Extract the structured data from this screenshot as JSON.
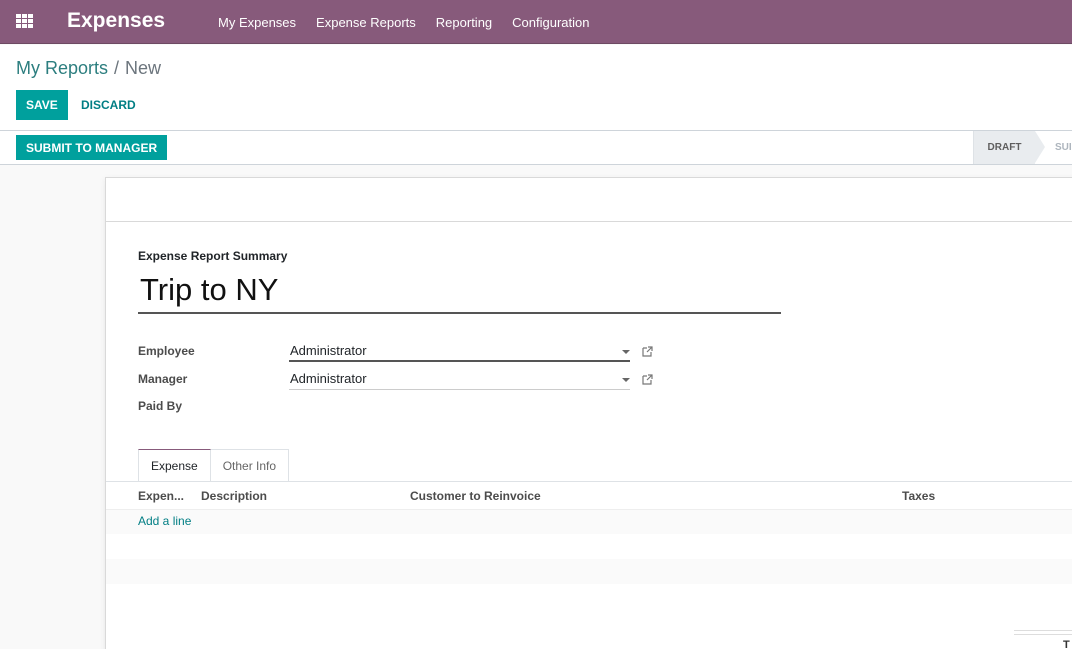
{
  "navbar": {
    "apps_icon": "apps-grid-icon",
    "brand": "Expenses",
    "menu": [
      {
        "label": "My Expenses"
      },
      {
        "label": "Expense Reports"
      },
      {
        "label": "Reporting"
      },
      {
        "label": "Configuration"
      }
    ]
  },
  "breadcrumb": {
    "parent": "My Reports",
    "separator": "/",
    "current": "New"
  },
  "actions": {
    "save": "SAVE",
    "discard": "DISCARD"
  },
  "statusbar": {
    "submit": "SUBMIT TO MANAGER",
    "stages": [
      {
        "label": "DRAFT",
        "active": true
      },
      {
        "label": "SUBMITTED",
        "visible_text": "SUI",
        "active": false
      }
    ]
  },
  "form": {
    "summary_label": "Expense Report Summary",
    "title": "Trip to NY",
    "fields": [
      {
        "label": "Employee",
        "value": "Administrator"
      },
      {
        "label": "Manager",
        "value": "Administrator"
      },
      {
        "label": "Paid By",
        "value": ""
      }
    ]
  },
  "tabs": [
    {
      "label": "Expense",
      "active": true
    },
    {
      "label": "Other Info",
      "active": false
    }
  ],
  "table": {
    "columns": [
      "Expen...",
      "Description",
      "Customer to Reinvoice",
      "Taxes"
    ],
    "add_line": "Add a line",
    "rows": []
  },
  "totals": {
    "label_partial": "T"
  },
  "colors": {
    "navbar": "#875a7b",
    "primary": "#00a09d",
    "link": "#017e84"
  }
}
